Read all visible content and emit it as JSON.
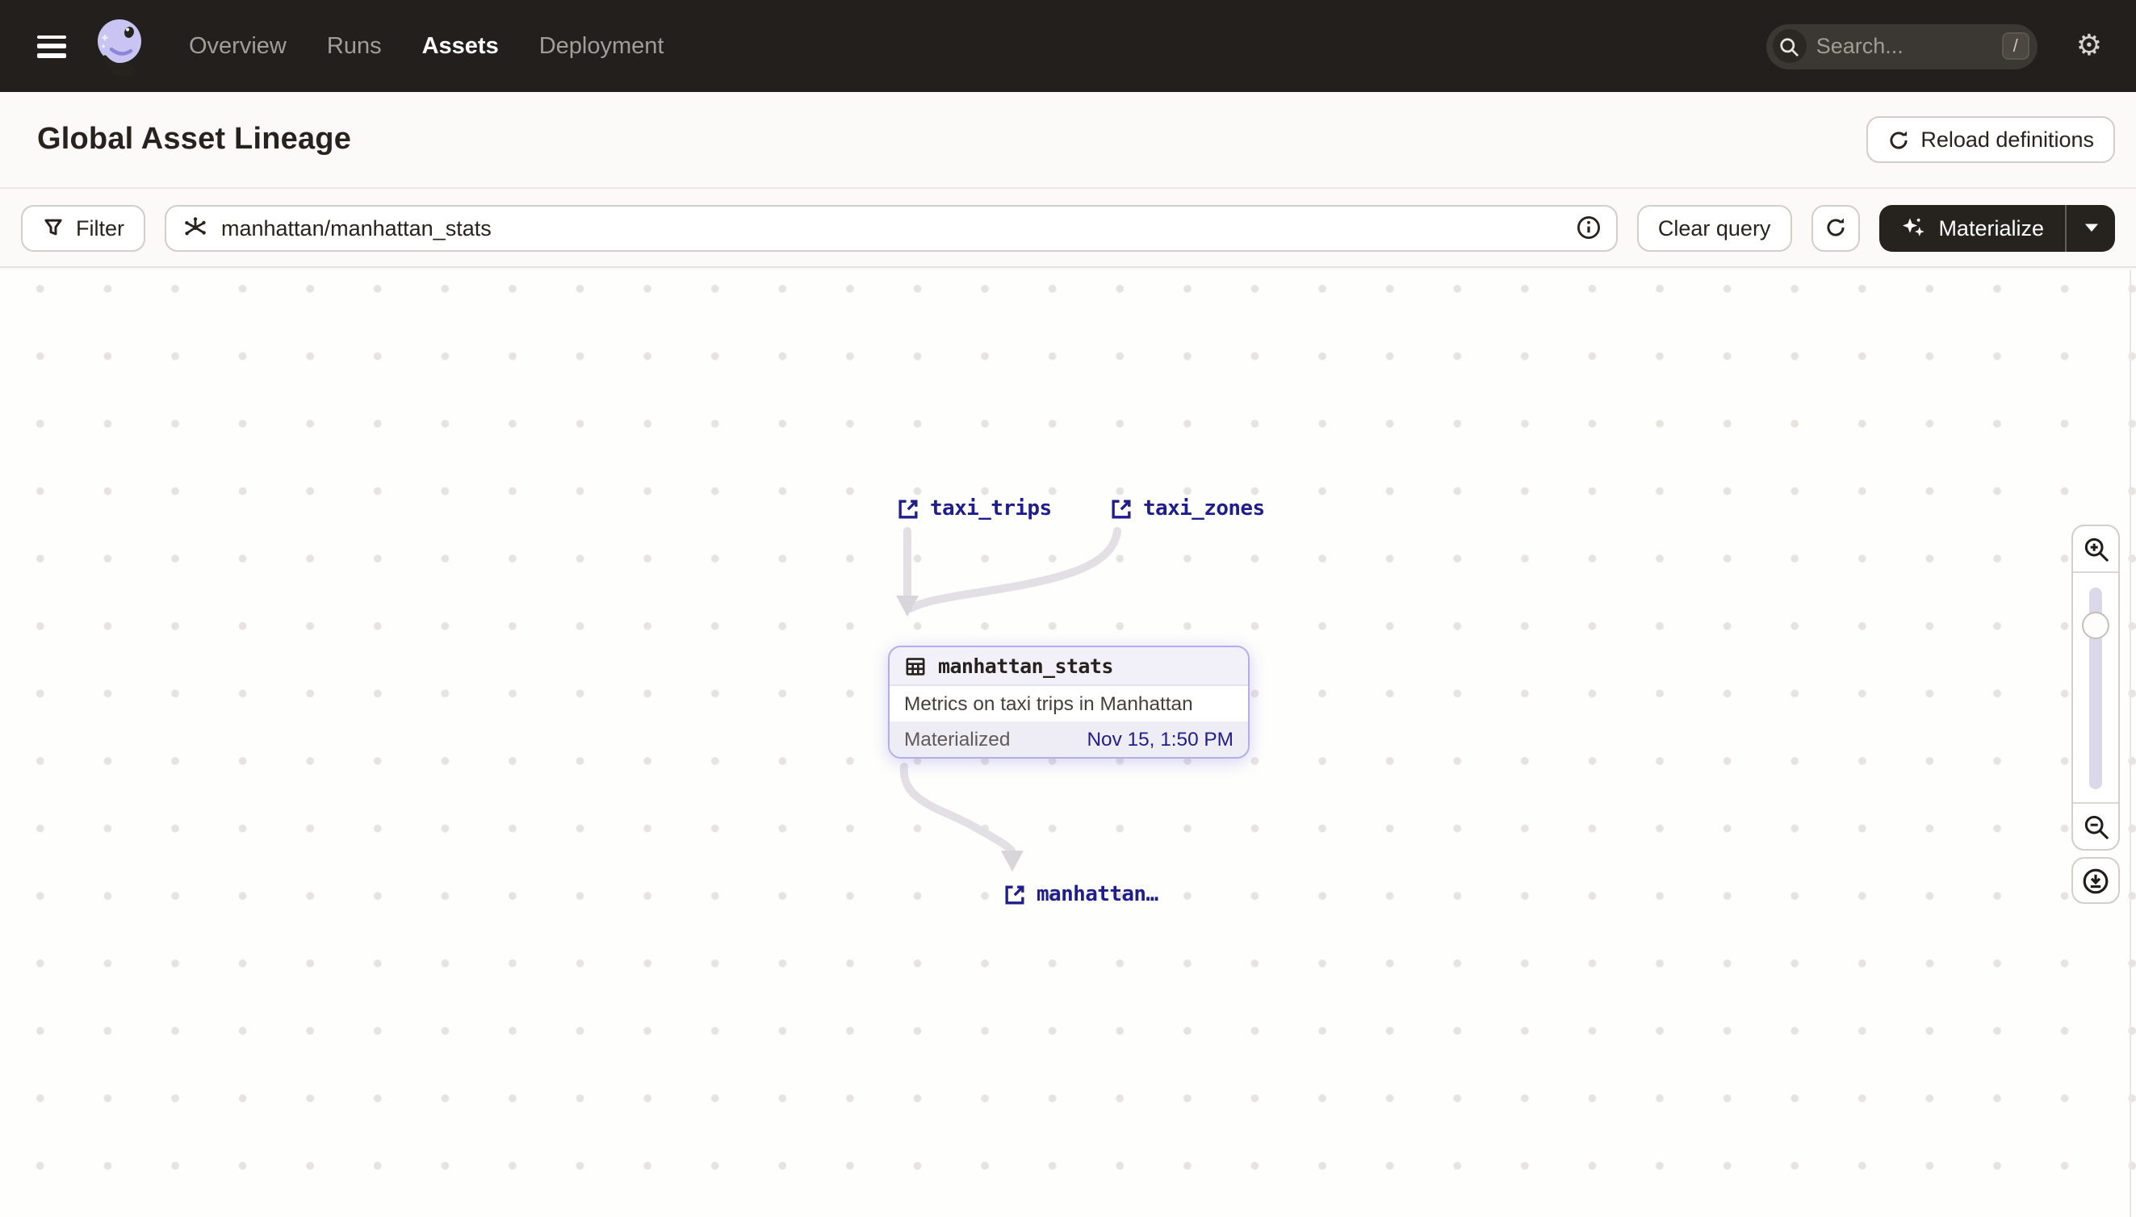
{
  "header": {
    "nav": [
      {
        "label": "Overview",
        "active": false
      },
      {
        "label": "Runs",
        "active": false
      },
      {
        "label": "Assets",
        "active": true
      },
      {
        "label": "Deployment",
        "active": false
      }
    ],
    "search": {
      "placeholder": "Search...",
      "shortcut": "/"
    },
    "gear_icon": "gear-icon"
  },
  "page_header": {
    "title": "Global Asset Lineage",
    "reload_label": "Reload definitions"
  },
  "toolbar": {
    "filter_label": "Filter",
    "query": "manhattan/manhattan_stats",
    "clear_label": "Clear query",
    "materialize_label": "Materialize"
  },
  "lineage": {
    "upstream_assets": [
      {
        "name": "taxi_trips"
      },
      {
        "name": "taxi_zones"
      }
    ],
    "selected_node": {
      "name": "manhattan_stats",
      "description": "Metrics on taxi trips in Manhattan",
      "status": "Materialized",
      "materialized_at": "Nov 15, 1:50 PM"
    },
    "downstream_assets": [
      {
        "name": "manhattan…"
      }
    ],
    "edges": [
      {
        "from": "taxi_trips",
        "to": "manhattan_stats"
      },
      {
        "from": "taxi_zones",
        "to": "manhattan_stats"
      },
      {
        "from": "manhattan_stats",
        "to": "manhattan…"
      }
    ]
  },
  "colors": {
    "header_bg": "#231F1C",
    "node_accent": "#B4ADE9",
    "link_navy": "#201D8C",
    "edge_gray": "#E2E0E4"
  }
}
